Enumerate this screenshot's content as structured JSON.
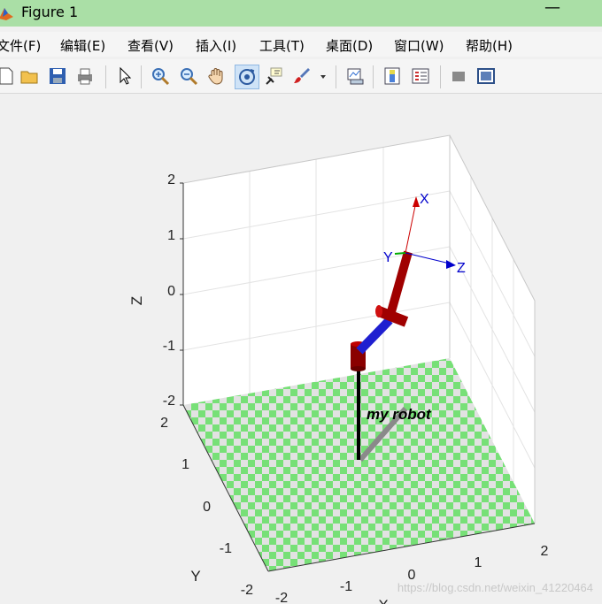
{
  "window": {
    "title": "Figure 1",
    "minimize_glyph": "—"
  },
  "menu": [
    {
      "label": "文件(F)"
    },
    {
      "label": "编辑(E)"
    },
    {
      "label": "查看(V)"
    },
    {
      "label": "插入(I)"
    },
    {
      "label": "工具(T)"
    },
    {
      "label": "桌面(D)"
    },
    {
      "label": "窗口(W)"
    },
    {
      "label": "帮助(H)"
    }
  ],
  "toolbar": [
    "new-figure-icon",
    "open-folder-icon",
    "save-icon",
    "print-icon",
    "pointer-icon",
    "zoom-in-icon",
    "zoom-out-icon",
    "pan-hand-icon",
    "rotate-3d-icon",
    "data-cursor-icon",
    "brush-icon",
    "brush-dropdown-icon",
    "link-plot-icon",
    "colorbar-icon",
    "legend-icon",
    "hide-plot-tools-icon",
    "show-plot-tools-icon"
  ],
  "axes": {
    "z_label": "Z",
    "y_label": "Y",
    "x_label": "X",
    "z_ticks": [
      "2",
      "1",
      "0",
      "-1",
      "-2"
    ],
    "y_ticks": [
      "2",
      "1",
      "0",
      "-1",
      "-2"
    ],
    "x_ticks": [
      "-2",
      "-1",
      "0",
      "1",
      "2"
    ]
  },
  "robot": {
    "name": "my robot",
    "frame_labels": {
      "x": "X",
      "y": "Y",
      "z": "Z"
    }
  },
  "colors": {
    "titlebar": "#aadfa6",
    "floor_green": "#77e077",
    "floor_gray": "#e2e2e2",
    "link_red": "#b00000",
    "link_blue": "#1f1fd0",
    "frame_blue": "#0000cc",
    "frame_red": "#cc0000"
  },
  "watermark": "https://blog.csdn.net/weixin_41220464"
}
